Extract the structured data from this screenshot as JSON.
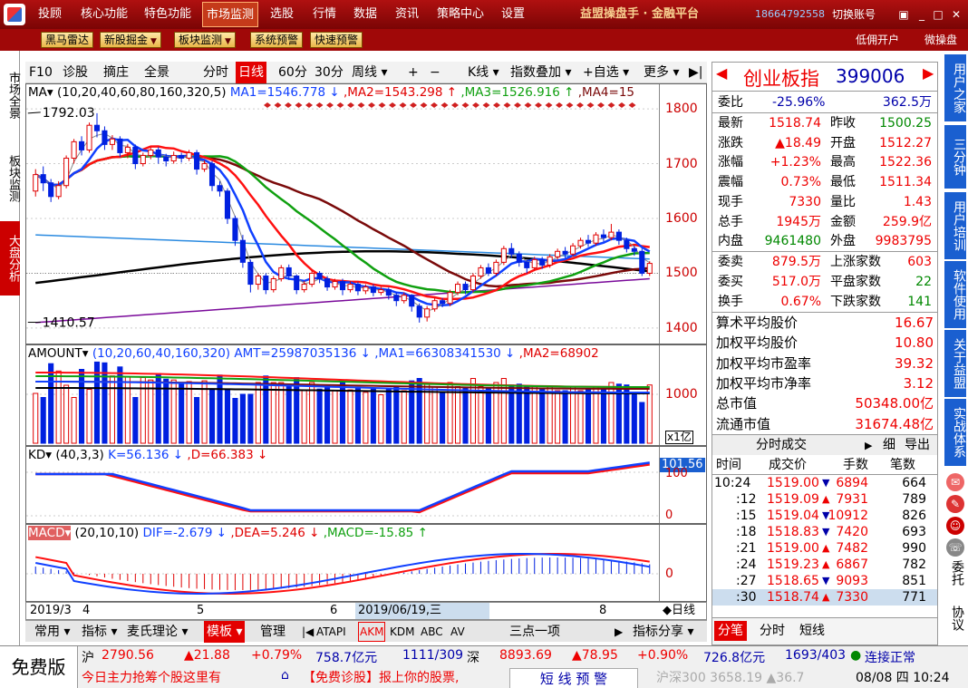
{
  "menu": [
    "投顾",
    "核心功能",
    "特色功能",
    "市场监测",
    "选股",
    "行情",
    "数据",
    "资讯",
    "策略中心",
    "设置"
  ],
  "menu_active": "市场监测",
  "brand": "益盟操盘手 · 金融平台",
  "phone": "18664792558",
  "switch_account": "切换账号",
  "toolbar2": [
    {
      "label": "黑马雷达",
      "dd": false
    },
    {
      "label": "新股掘金",
      "dd": true
    },
    {
      "label": "板块监测",
      "dd": true
    },
    {
      "label": "系统预警",
      "dd": false
    },
    {
      "label": "快速预警",
      "dd": false
    }
  ],
  "toolbar2_right": [
    "低佣开户",
    "微操盘"
  ],
  "left_tabs": [
    "市场全景",
    "板块监测",
    "大盘分析"
  ],
  "left_active": "大盘分析",
  "chart_toolbar": [
    "F10",
    "诊股",
    "摘庄",
    "全景",
    "分时",
    "日线",
    "60分",
    "30分",
    "周线 ▾",
    "+",
    "−",
    "K线 ▾",
    "指数叠加 ▾",
    "+自选 ▾",
    "更多 ▾",
    "▶|"
  ],
  "chart_toolbar_active": "日线",
  "ma_legend": {
    "label": "MA▾",
    "params": "(10,20,40,60,80,160,320,5)",
    "ma1": "MA1=1546.778 ↓",
    "ma2": ",MA2=1543.298 ↑",
    "ma3": ",MA3=1526.916 ↑",
    "ma4": ",MA4=15"
  },
  "amount_legend": {
    "label": "AMOUNT▾",
    "params": "(10,20,60,40,160,320)",
    "amt": "AMT=25987035136 ↓",
    "ma1": ",MA1=66308341530 ↓",
    "ma2": ",MA2=68902"
  },
  "amount_unit": "x1亿",
  "kd_legend": {
    "label": "KD▾",
    "params": "(40,3,3)",
    "k": "K=56.136 ↓",
    "d": ",D=66.383 ↓"
  },
  "kd_readout": "101.56",
  "macd_legend": {
    "label": "MACD▾",
    "params": "(20,10,10)",
    "dif": "DIF=-2.679 ↓",
    "dea": ",DEA=5.246 ↓",
    "macd": ",MACD=-15.85 ↑"
  },
  "price_high_label": "1792.03",
  "price_low_label": "1410.57",
  "date_labels": [
    "2019/3",
    "4",
    "5",
    "6",
    "2019/06/19,三",
    "8"
  ],
  "date_mode": "◆日线",
  "bottom_tabs": [
    "常用 ▾",
    "指标 ▾",
    "麦氏理论 ▾",
    "模板 ▾",
    "管理",
    "|◀",
    "ATAPI",
    "AKM",
    "KDM",
    "ABC",
    "AV",
    "三点一项",
    "▶",
    "指标分享 ▾"
  ],
  "bottom_active": "模板",
  "quote": {
    "name": "创业板指",
    "code": "399006",
    "weibi_label": "委比",
    "weibi": "-25.96%",
    "weicha": "362.5万",
    "rows": [
      [
        "最新",
        "1518.74",
        "red",
        "昨收",
        "1500.25",
        "grn"
      ],
      [
        "涨跌",
        "▲18.49",
        "red",
        "开盘",
        "1512.27",
        "red"
      ],
      [
        "涨幅",
        "+1.23%",
        "red",
        "最高",
        "1522.36",
        "red"
      ],
      [
        "震幅",
        "0.73%",
        "red",
        "最低",
        "1511.34",
        "red"
      ],
      [
        "现手",
        "7330",
        "red",
        "量比",
        "1.43",
        "red"
      ],
      [
        "总手",
        "1945万",
        "red",
        "金额",
        "259.9亿",
        "red"
      ],
      [
        "内盘",
        "9461480",
        "grn",
        "外盘",
        "9983795",
        "red"
      ]
    ],
    "rows2": [
      [
        "委卖",
        "879.5万",
        "red",
        "上涨家数",
        "603",
        "red"
      ],
      [
        "委买",
        "517.0万",
        "red",
        "平盘家数",
        "22",
        "grn"
      ],
      [
        "换手",
        "0.67%",
        "red",
        "下跌家数",
        "141",
        "grn"
      ]
    ],
    "rows3": [
      [
        "算术平均股价",
        "16.67"
      ],
      [
        "加权平均股价",
        "10.80"
      ],
      [
        "加权平均市盈率",
        "39.32"
      ],
      [
        "加权平均市净率",
        "3.12"
      ],
      [
        "总市值",
        "50348.00亿"
      ],
      [
        "流通市值",
        "31674.48亿"
      ]
    ],
    "trades_title": "分时成交",
    "trades_btns": [
      "▶",
      "细",
      "导出"
    ],
    "trades_head": [
      "时间",
      "成交价",
      "手数",
      "笔数"
    ],
    "trades": [
      [
        "10:24",
        "1519.00",
        "▼",
        "6894",
        "664"
      ],
      [
        ":12",
        "1519.09",
        "▲",
        "7931",
        "789"
      ],
      [
        ":15",
        "1519.04",
        "▼",
        "10912",
        "826"
      ],
      [
        ":18",
        "1518.83",
        "▼",
        "7420",
        "693"
      ],
      [
        ":21",
        "1519.00",
        "▲",
        "7482",
        "990"
      ],
      [
        ":24",
        "1519.23",
        "▲",
        "6867",
        "782"
      ],
      [
        ":27",
        "1518.65",
        "▼",
        "9093",
        "851"
      ],
      [
        ":30",
        "1518.74",
        "▲",
        "7330",
        "771"
      ]
    ],
    "bottom_tabs": [
      "分笔",
      "分时",
      "短线"
    ]
  },
  "right_tabs": [
    "用户之家",
    "三分钟",
    "用户培训",
    "软件使用",
    "关于益盟",
    "实战体系"
  ],
  "right_small": [
    "委托",
    "协议"
  ],
  "status": {
    "free": "免费版",
    "sh_label": "沪",
    "sh_price": "2790.56",
    "sh_chg": "▲21.88",
    "sh_pct": "+0.79%",
    "sh_amt": "758.7亿元",
    "sh_cnt": "1111/309",
    "sz_label": "深",
    "sz_price": "8893.69",
    "sz_chg": "▲78.95",
    "sz_pct": "+0.90%",
    "sz_amt": "726.8亿元",
    "sz_cnt": "1693/403",
    "conn": "连接正常",
    "ticker": "今日主力抢筹个股这里有",
    "ticker2": "【免费诊股】报上你的股票,",
    "alert": "短 线 预 警",
    "hs300": "沪深300  3658.19  ▲36.7",
    "date": "08/08 四 10:24"
  },
  "colors": {
    "up": "#e00000",
    "down": "#0020e0",
    "ma_black": "#000000",
    "ma_blue": "#1040ff",
    "ma_red": "#ff1010",
    "ma_green": "#10a010",
    "ma_dkred": "#7a0a0a",
    "ma_purple": "#7a0a9a",
    "ma_cyan": "#2a8ae0"
  },
  "chart_data": [
    {
      "type": "candlestick",
      "title": "创业板指 日线",
      "y_ticks": [
        1400,
        1500,
        1600,
        1700,
        1800
      ],
      "ylim": [
        1385,
        1815
      ],
      "x_labels": [
        "2019/3",
        "4",
        "5",
        "6",
        "8"
      ],
      "annotations": [
        {
          "text": "1792.03",
          "value": 1792.03
        },
        {
          "text": "1410.57",
          "value": 1410.57
        }
      ],
      "candles": [
        [
          1650,
          1680,
          1640,
          1690
        ],
        [
          1680,
          1665,
          1650,
          1695
        ],
        [
          1665,
          1640,
          1630,
          1672
        ],
        [
          1640,
          1660,
          1635,
          1668
        ],
        [
          1660,
          1710,
          1655,
          1715
        ],
        [
          1710,
          1740,
          1700,
          1745
        ],
        [
          1740,
          1725,
          1715,
          1750
        ],
        [
          1725,
          1770,
          1720,
          1775
        ],
        [
          1770,
          1760,
          1748,
          1792
        ],
        [
          1760,
          1735,
          1725,
          1768
        ],
        [
          1735,
          1745,
          1725,
          1752
        ],
        [
          1745,
          1720,
          1712,
          1750
        ],
        [
          1720,
          1730,
          1710,
          1736
        ],
        [
          1730,
          1700,
          1690,
          1735
        ],
        [
          1700,
          1715,
          1695,
          1720
        ],
        [
          1715,
          1725,
          1708,
          1730
        ],
        [
          1725,
          1712,
          1700,
          1730
        ],
        [
          1712,
          1705,
          1695,
          1718
        ],
        [
          1705,
          1715,
          1700,
          1722
        ],
        [
          1715,
          1710,
          1702,
          1720
        ],
        [
          1710,
          1720,
          1705,
          1725
        ],
        [
          1720,
          1690,
          1680,
          1725
        ],
        [
          1690,
          1700,
          1685,
          1706
        ],
        [
          1700,
          1660,
          1650,
          1705
        ],
        [
          1660,
          1650,
          1640,
          1668
        ],
        [
          1650,
          1600,
          1590,
          1655
        ],
        [
          1600,
          1560,
          1550,
          1605
        ],
        [
          1560,
          1520,
          1510,
          1570
        ],
        [
          1520,
          1480,
          1465,
          1525
        ],
        [
          1480,
          1495,
          1470,
          1500
        ],
        [
          1495,
          1470,
          1462,
          1500
        ],
        [
          1470,
          1490,
          1465,
          1495
        ],
        [
          1490,
          1510,
          1485,
          1515
        ],
        [
          1510,
          1495,
          1488,
          1516
        ],
        [
          1495,
          1470,
          1462,
          1498
        ],
        [
          1470,
          1480,
          1465,
          1486
        ],
        [
          1480,
          1500,
          1475,
          1505
        ],
        [
          1500,
          1490,
          1482,
          1504
        ],
        [
          1490,
          1475,
          1468,
          1495
        ],
        [
          1475,
          1485,
          1470,
          1490
        ],
        [
          1485,
          1470,
          1460,
          1490
        ],
        [
          1470,
          1480,
          1465,
          1486
        ],
        [
          1480,
          1468,
          1460,
          1484
        ],
        [
          1468,
          1475,
          1462,
          1480
        ],
        [
          1475,
          1465,
          1458,
          1480
        ],
        [
          1465,
          1470,
          1460,
          1475
        ],
        [
          1470,
          1460,
          1452,
          1474
        ],
        [
          1460,
          1450,
          1440,
          1465
        ],
        [
          1450,
          1460,
          1445,
          1465
        ],
        [
          1460,
          1440,
          1430,
          1462
        ],
        [
          1440,
          1420,
          1410,
          1445
        ],
        [
          1420,
          1435,
          1412,
          1440
        ],
        [
          1435,
          1450,
          1430,
          1455
        ],
        [
          1450,
          1445,
          1438,
          1455
        ],
        [
          1445,
          1465,
          1440,
          1470
        ],
        [
          1465,
          1480,
          1460,
          1485
        ],
        [
          1480,
          1470,
          1462,
          1485
        ],
        [
          1470,
          1495,
          1465,
          1500
        ],
        [
          1495,
          1510,
          1490,
          1515
        ],
        [
          1510,
          1500,
          1495,
          1518
        ],
        [
          1500,
          1520,
          1495,
          1525
        ],
        [
          1520,
          1545,
          1515,
          1550
        ],
        [
          1545,
          1535,
          1528,
          1555
        ],
        [
          1535,
          1520,
          1512,
          1540
        ],
        [
          1520,
          1510,
          1500,
          1525
        ],
        [
          1510,
          1525,
          1505,
          1530
        ],
        [
          1525,
          1515,
          1508,
          1530
        ],
        [
          1515,
          1530,
          1510,
          1535
        ],
        [
          1530,
          1540,
          1525,
          1545
        ],
        [
          1540,
          1535,
          1528,
          1548
        ],
        [
          1535,
          1550,
          1530,
          1555
        ],
        [
          1550,
          1560,
          1545,
          1565
        ],
        [
          1560,
          1555,
          1548,
          1570
        ],
        [
          1555,
          1570,
          1550,
          1575
        ],
        [
          1570,
          1565,
          1558,
          1580
        ],
        [
          1565,
          1575,
          1560,
          1590
        ],
        [
          1575,
          1560,
          1552,
          1580
        ],
        [
          1560,
          1545,
          1538,
          1565
        ],
        [
          1545,
          1540,
          1532,
          1550
        ],
        [
          1540,
          1500,
          1495,
          1545
        ],
        [
          1500,
          1518,
          1495,
          1522
        ]
      ]
    },
    {
      "type": "bar",
      "title": "AMOUNT",
      "y_ticks": [
        1000
      ],
      "unit": "x1亿"
    },
    {
      "type": "line",
      "title": "KD",
      "y_ticks": [
        0,
        100
      ]
    },
    {
      "type": "bar",
      "title": "MACD",
      "y_ticks": [
        0
      ]
    }
  ]
}
